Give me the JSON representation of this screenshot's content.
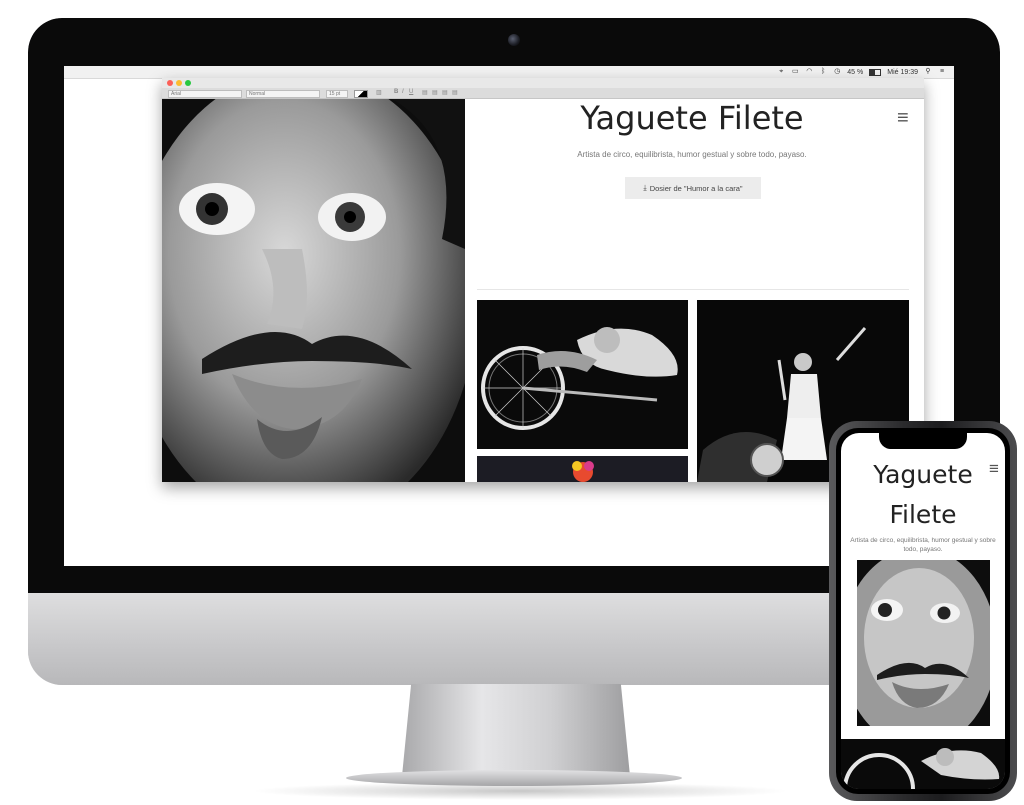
{
  "menubar": {
    "battery": "45 %",
    "clock": "Mié 19:39"
  },
  "toolbar": {
    "font": "Arial",
    "style": "Normal",
    "size": "15 pt"
  },
  "site": {
    "title": "Yaguete Filete",
    "subtitle": "Artista de circo, equilibrista, humor gestual y sobre todo, payaso.",
    "dossier_label": "Dosier de \"Humor a la cara\""
  },
  "mobile": {
    "title_line1": "Yaguete",
    "title_line2": "Filete",
    "subtitle": "Artista de circo, equilibrista, humor gestual y sobre todo, payaso."
  },
  "icons": {
    "menu": "hamburger-icon",
    "download": "download-icon"
  },
  "colors": {
    "title": "#222222",
    "subtitle": "#777777",
    "button_bg": "#ececec",
    "imac_bezel": "#0a0a0a"
  }
}
